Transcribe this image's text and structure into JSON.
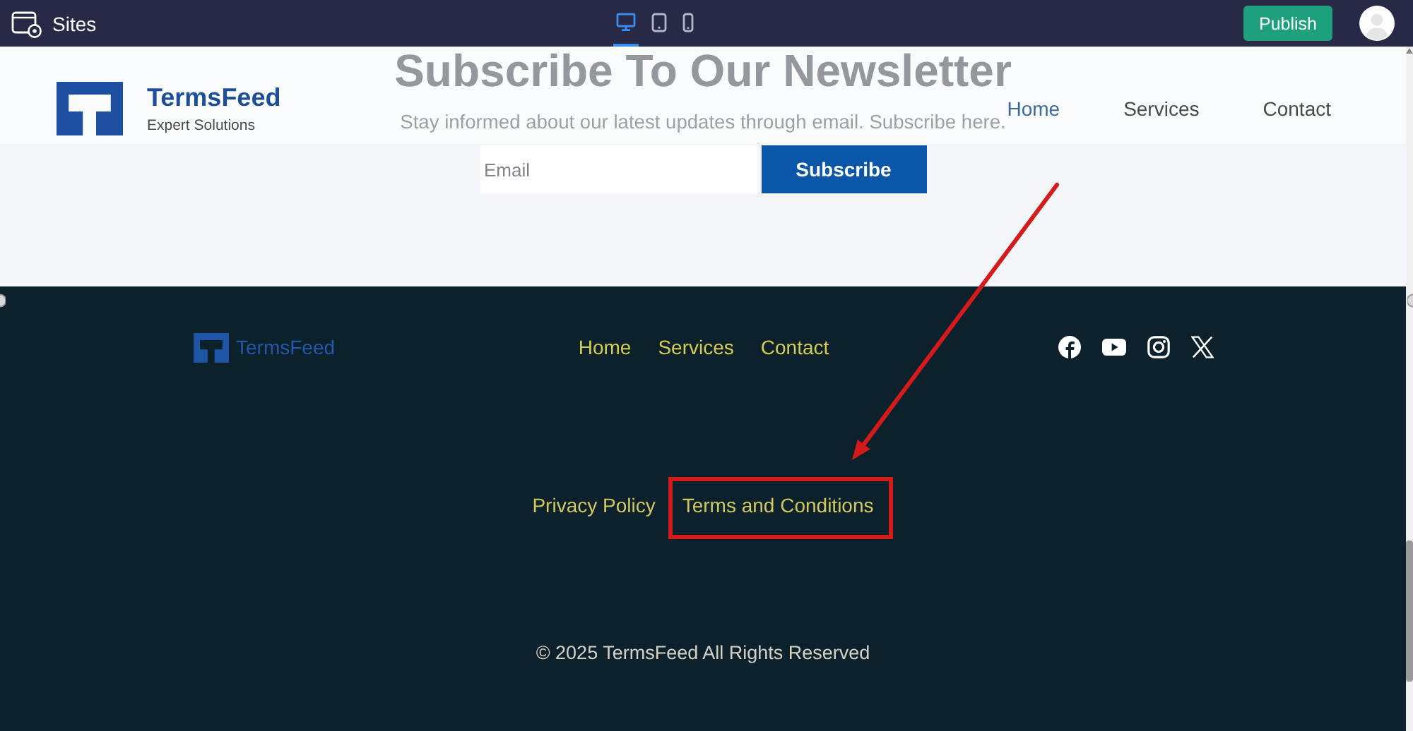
{
  "editor_bar": {
    "title": "Sites",
    "devices": [
      {
        "kind": "desktop",
        "selected": true
      },
      {
        "kind": "tablet",
        "selected": false
      },
      {
        "kind": "phone",
        "selected": false
      }
    ],
    "publish_button": "Publish"
  },
  "header": {
    "brand": "TermsFeed",
    "tagline": "Expert Solutions",
    "nav": [
      {
        "label": "Home",
        "selected": true
      },
      {
        "label": "Services",
        "selected": false
      },
      {
        "label": "Contact",
        "selected": false
      }
    ]
  },
  "newsletter": {
    "title": "Subscribe To Our Newsletter",
    "subtitle": "Stay informed about our latest updates through email. Subscribe here.",
    "email_field": {
      "placeholder": "Email"
    },
    "subscribe_button": "Subscribe"
  },
  "footer": {
    "brand": "TermsFeed",
    "nav": [
      "Home",
      "Services",
      "Contact"
    ],
    "social": [
      {
        "kind": "facebook"
      },
      {
        "kind": "youtube"
      },
      {
        "kind": "instagram"
      },
      {
        "kind": "x"
      }
    ],
    "legal_links": [
      {
        "label": "Privacy Policy",
        "highlighted": false
      },
      {
        "label": "Terms and Conditions",
        "highlighted": true
      }
    ],
    "copyright": "© 2025 TermsFeed All Rights Reserved"
  }
}
